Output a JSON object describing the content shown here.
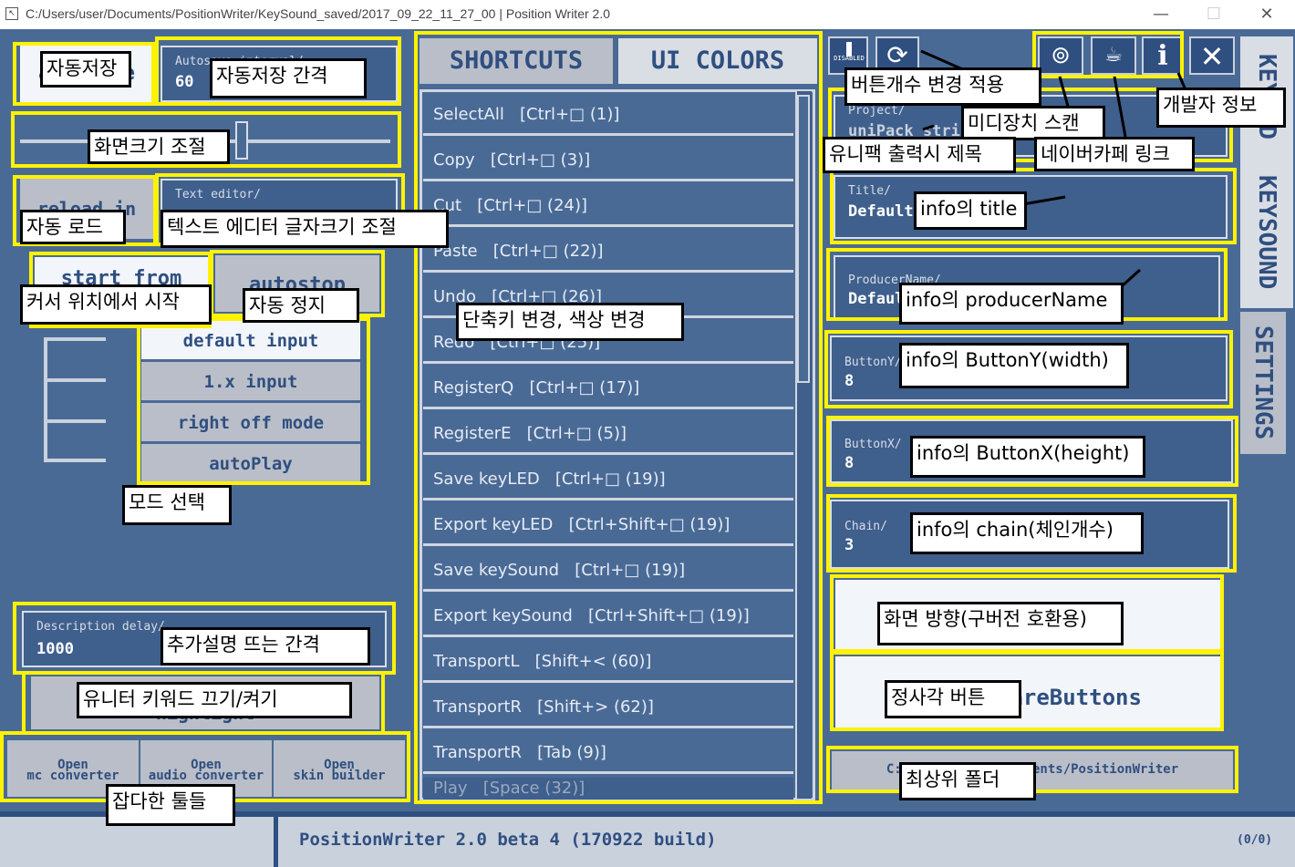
{
  "window": {
    "title": "C:/Users/user/Documents/PositionWriter/KeySound_saved/2017_09_22_11_27_00 | Position Writer 2.0",
    "app_icon": "app-icon",
    "minimize": "—",
    "maximize": "☐",
    "close": "✕"
  },
  "left": {
    "autosave_button": "autosave",
    "autosave_interval_label": "Autosave interval/",
    "autosave_interval_value": "60",
    "reload_button": "reload in",
    "text_editor_label": "Text editor/",
    "start_from_button": "start from",
    "autostop_button": "autostop",
    "modes": [
      "default input",
      "1.x input",
      "right off mode",
      "autoPlay"
    ],
    "description_delay_label": "Description delay/",
    "description_delay_value": "1000",
    "unitor_keyword_button": "highlight",
    "tools": [
      {
        "line1": "Open",
        "line2": "mc converter"
      },
      {
        "line1": "Open",
        "line2": "audio converter"
      },
      {
        "line1": "Open",
        "line2": "skin builder"
      }
    ]
  },
  "middle": {
    "tabs": [
      "SHORTCUTS",
      "UI COLORS"
    ],
    "shortcuts": [
      "SelectAll   [Ctrl+□ (1)]",
      "Copy   [Ctrl+□ (3)]",
      "Cut   [Ctrl+□ (24)]",
      "Paste   [Ctrl+□ (22)]",
      "Undo   [Ctrl+□ (26)]",
      "Redo   [Ctrl+□ (25)]",
      "RegisterQ   [Ctrl+□ (17)]",
      "RegisterE   [Ctrl+□ (5)]",
      "Save keyLED   [Ctrl+□ (19)]",
      "Export keyLED   [Ctrl+Shift+□ (19)]",
      "Save keySound   [Ctrl+□ (19)]",
      "Export keySound   [Ctrl+Shift+□ (19)]",
      "TransportL   [Shift+< (60)]",
      "TransportR   [Shift+> (62)]",
      "TransportR   [Tab (9)]",
      "Play   [Space (32)]"
    ]
  },
  "right": {
    "icons": [
      "disabled-icon",
      "refresh-icon",
      "midi-icon",
      "cafe-icon",
      "info-icon",
      "close-icon"
    ],
    "disabled_text": "DISABLED",
    "project_label": "Project/",
    "project_value": "uniPack_string",
    "title_label": "Title/",
    "title_value": "Default",
    "producer_label": "ProducerName/",
    "producer_value": "Default",
    "buttony_label": "ButtonY/",
    "buttony_value": "8",
    "buttonx_label": "ButtonX/",
    "buttonx_value": "8",
    "chain_label": "Chain/",
    "chain_value": "3",
    "landscape_button": "",
    "square_button": "squareButtons",
    "folder_path": "C:/Users/user/Documents/PositionWriter",
    "side_tabs": [
      "KEYLED",
      "KEYSOUND",
      "SETTINGS"
    ]
  },
  "status": {
    "version": "PositionWriter 2.0 beta 4 (170922 build)",
    "count": "(0/0)"
  },
  "annotations": {
    "autosave": "자동저장",
    "autosave_interval": "자동저장 간격",
    "screen_size": "화면크기 조절",
    "auto_load": "자동 로드",
    "text_editor_font": "텍스트 에디터 글자크기 조절",
    "start_cursor": "커서 위치에서 시작",
    "auto_stop": "자동 정지",
    "mode_select": "모드 선택",
    "desc_delay": "추가설명 뜨는 간격",
    "unitor_keyword": "유니터 키워드 끄기/켜기",
    "misc_tools": "잡다한 툴들",
    "shortcut_color": "단축키 변경, 색상 변경",
    "apply_buttons": "버튼개수 변경 적용",
    "midi_scan": "미디장치 스캔",
    "developer_info": "개발자 정보",
    "unipack_title": "유니팩 출력시 제목",
    "naver_cafe": "네이버카페 링크",
    "info_title": "info의 title",
    "info_producer": "info의 producerName",
    "info_buttony": "info의 ButtonY(width)",
    "info_buttonx": "info의 ButtonX(height)",
    "info_chain": "info의 chain(체인개수)",
    "orientation": "화면 방향(구버전 호환용)",
    "square_btn": "정사각 버튼",
    "top_folder": "최상위 폴더"
  },
  "colors": {
    "background": "#4a6a96",
    "dark_blue": "#2f4f80",
    "highlight": "#fff200"
  }
}
